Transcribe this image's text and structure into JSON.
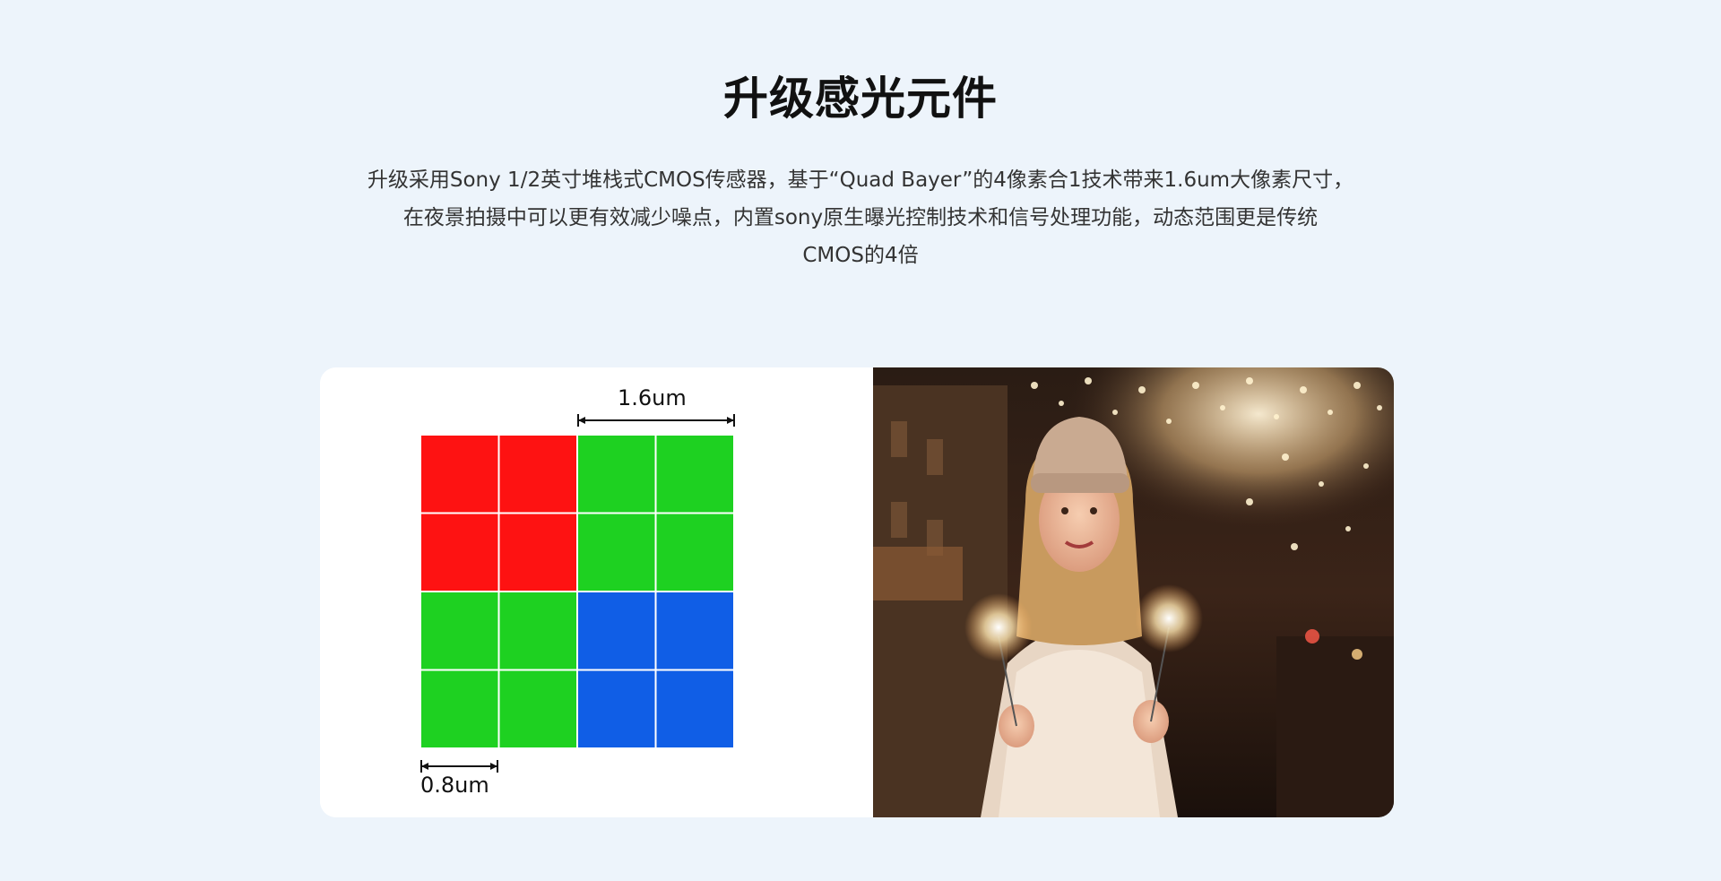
{
  "header": {
    "title": "升级感光元件"
  },
  "description": {
    "lines": [
      "升级采用Sony 1/2英寸堆栈式CMOS传感器，基于“Quad Bayer”的4像素合1技术带来1.6um大像素尺寸，",
      "在夜景拍摄中可以更有效减少噪点，内置sony原生曝光控制技术和信号处理功能，动态范围更是传统",
      "CMOS的4倍"
    ]
  },
  "diagram": {
    "large_pixel_label": "1.6um",
    "small_pixel_label": "0.8um",
    "colors": {
      "red": "#fe1212",
      "green": "#1ed121",
      "blue": "#105ee6",
      "grid_line": "#ffffff"
    },
    "grid": [
      [
        "red",
        "red",
        "green",
        "green"
      ],
      [
        "red",
        "red",
        "green",
        "green"
      ],
      [
        "green",
        "green",
        "blue",
        "blue"
      ],
      [
        "green",
        "green",
        "blue",
        "blue"
      ]
    ]
  },
  "photo": {
    "alt": "Woman in knit hat and scarf holding sparklers on a night street with bokeh lights"
  }
}
